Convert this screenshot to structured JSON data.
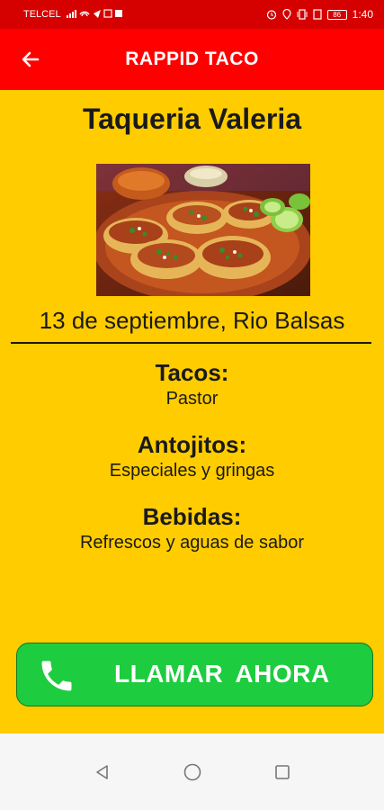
{
  "status_bar": {
    "carrier": "TELCEL",
    "battery": "86",
    "time": "1:40"
  },
  "app_bar": {
    "title": "RAPPID TACO",
    "back_icon": "arrow-left-icon"
  },
  "restaurant": {
    "name": "Taqueria Valeria",
    "date_place": "13 de septiembre, Rio Balsas"
  },
  "menu": [
    {
      "heading": "Tacos:",
      "detail": "Pastor"
    },
    {
      "heading": "Antojitos:",
      "detail": "Especiales y gringas"
    },
    {
      "heading": "Bebidas:",
      "detail": "Refrescos y aguas de sabor"
    }
  ],
  "call_button": {
    "label": "LLAMAR AHORA",
    "icon": "phone-icon"
  },
  "colors": {
    "status_bar": "#d50000",
    "app_bar": "#ff0000",
    "background": "#ffcc00",
    "call_button": "#1ecc3f"
  }
}
